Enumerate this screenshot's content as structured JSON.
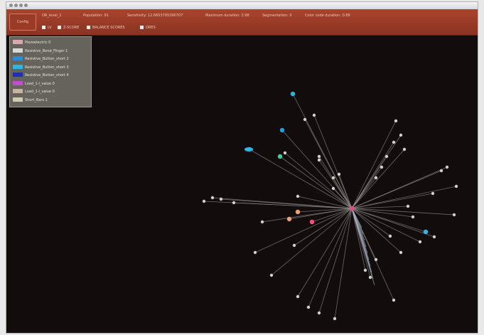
{
  "window": {
    "menu_button": "Config",
    "stats": [
      "OR_level_1",
      "Population: 91",
      "Sensitivity: 12.6653795390707",
      "Maximum duration: 3.98",
      "Segmentation: 0",
      "Color code duration: 0.89"
    ],
    "checkboxes": [
      "LV",
      "Z-SCORE",
      "BALANCE SCORES",
      "ORES"
    ]
  },
  "legend": {
    "items": [
      {
        "label": "Piezoelectric 0",
        "color": "#d9a7b0"
      },
      {
        "label": "Resistive_Bend_Finger 1",
        "color": "#d9d9d9"
      },
      {
        "label": "Resistive_Button_short 2",
        "color": "#2c8ad6"
      },
      {
        "label": "Resistive_Button_short 3",
        "color": "#2bb6e8"
      },
      {
        "label": "Resistive_Button_short 4",
        "color": "#1e2fb0"
      },
      {
        "label": "Load_1-l_value 0",
        "color": "#c14fc8"
      },
      {
        "label": "Load_1-l_value 0",
        "color": "#c8b4a0"
      },
      {
        "label": "Short_Bars 1",
        "color": "#cfcbb2"
      }
    ]
  },
  "graph": {
    "hub_color": "#e24b8c",
    "edge_color": "#8c8a86",
    "default_node_color": "#d4d0c8",
    "node_colors": [
      "#2bb6e8",
      "#1e9fe0",
      "#3ecf9f",
      "#e9a07a",
      "#ff4d7e",
      "#b77ad1"
    ]
  }
}
